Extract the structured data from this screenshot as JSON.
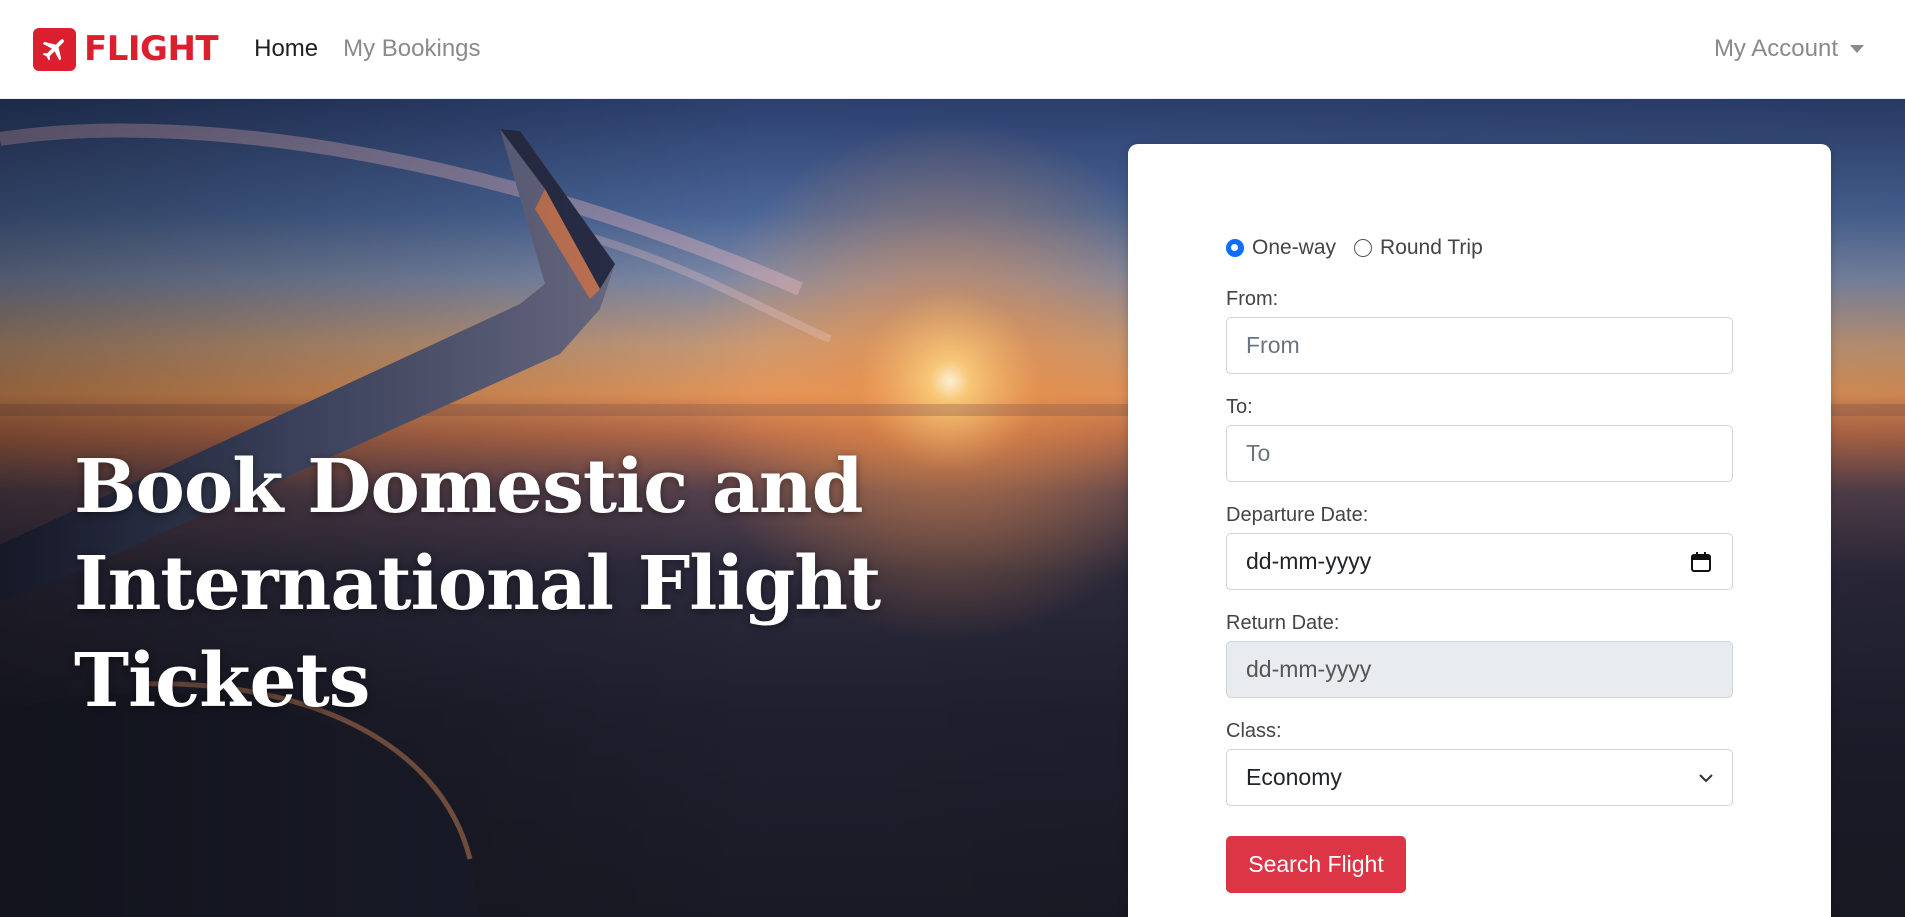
{
  "brand": {
    "name": "FLIGHT",
    "color": "#dc1f2e"
  },
  "nav": {
    "links": [
      {
        "label": "Home",
        "active": true
      },
      {
        "label": "My Bookings",
        "active": false
      }
    ],
    "account": "My Account"
  },
  "hero": {
    "title": "Book Domestic and International Flight Tickets"
  },
  "form": {
    "trip_types": [
      {
        "label": "One-way",
        "selected": true
      },
      {
        "label": "Round Trip",
        "selected": false
      }
    ],
    "from": {
      "label": "From:",
      "placeholder": "From"
    },
    "to": {
      "label": "To:",
      "placeholder": "To"
    },
    "departure": {
      "label": "Departure Date:",
      "placeholder": "dd-mm-yyyy"
    },
    "return": {
      "label": "Return Date:",
      "placeholder": "dd-mm-yyyy",
      "disabled": true
    },
    "class": {
      "label": "Class:",
      "value": "Economy"
    },
    "submit": "Search Flight"
  },
  "colors": {
    "accent": "#dc3545",
    "radio": "#0d6efd"
  }
}
